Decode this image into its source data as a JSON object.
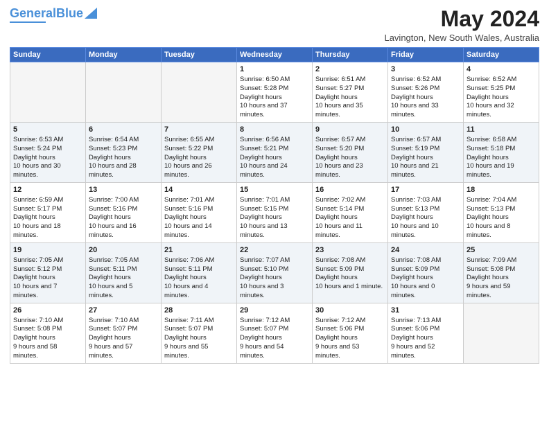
{
  "header": {
    "logo_general": "General",
    "logo_blue": "Blue",
    "month_title": "May 2024",
    "location": "Lavington, New South Wales, Australia"
  },
  "days_of_week": [
    "Sunday",
    "Monday",
    "Tuesday",
    "Wednesday",
    "Thursday",
    "Friday",
    "Saturday"
  ],
  "weeks": [
    [
      {
        "day": "",
        "empty": true,
        "sunrise": "",
        "sunset": "",
        "daylight": ""
      },
      {
        "day": "",
        "empty": true,
        "sunrise": "",
        "sunset": "",
        "daylight": ""
      },
      {
        "day": "",
        "empty": true,
        "sunrise": "",
        "sunset": "",
        "daylight": ""
      },
      {
        "day": "1",
        "empty": false,
        "sunrise": "6:50 AM",
        "sunset": "5:28 PM",
        "daylight": "10 hours and 37 minutes."
      },
      {
        "day": "2",
        "empty": false,
        "sunrise": "6:51 AM",
        "sunset": "5:27 PM",
        "daylight": "10 hours and 35 minutes."
      },
      {
        "day": "3",
        "empty": false,
        "sunrise": "6:52 AM",
        "sunset": "5:26 PM",
        "daylight": "10 hours and 33 minutes."
      },
      {
        "day": "4",
        "empty": false,
        "sunrise": "6:52 AM",
        "sunset": "5:25 PM",
        "daylight": "10 hours and 32 minutes."
      }
    ],
    [
      {
        "day": "5",
        "empty": false,
        "sunrise": "6:53 AM",
        "sunset": "5:24 PM",
        "daylight": "10 hours and 30 minutes."
      },
      {
        "day": "6",
        "empty": false,
        "sunrise": "6:54 AM",
        "sunset": "5:23 PM",
        "daylight": "10 hours and 28 minutes."
      },
      {
        "day": "7",
        "empty": false,
        "sunrise": "6:55 AM",
        "sunset": "5:22 PM",
        "daylight": "10 hours and 26 minutes."
      },
      {
        "day": "8",
        "empty": false,
        "sunrise": "6:56 AM",
        "sunset": "5:21 PM",
        "daylight": "10 hours and 24 minutes."
      },
      {
        "day": "9",
        "empty": false,
        "sunrise": "6:57 AM",
        "sunset": "5:20 PM",
        "daylight": "10 hours and 23 minutes."
      },
      {
        "day": "10",
        "empty": false,
        "sunrise": "6:57 AM",
        "sunset": "5:19 PM",
        "daylight": "10 hours and 21 minutes."
      },
      {
        "day": "11",
        "empty": false,
        "sunrise": "6:58 AM",
        "sunset": "5:18 PM",
        "daylight": "10 hours and 19 minutes."
      }
    ],
    [
      {
        "day": "12",
        "empty": false,
        "sunrise": "6:59 AM",
        "sunset": "5:17 PM",
        "daylight": "10 hours and 18 minutes."
      },
      {
        "day": "13",
        "empty": false,
        "sunrise": "7:00 AM",
        "sunset": "5:16 PM",
        "daylight": "10 hours and 16 minutes."
      },
      {
        "day": "14",
        "empty": false,
        "sunrise": "7:01 AM",
        "sunset": "5:16 PM",
        "daylight": "10 hours and 14 minutes."
      },
      {
        "day": "15",
        "empty": false,
        "sunrise": "7:01 AM",
        "sunset": "5:15 PM",
        "daylight": "10 hours and 13 minutes."
      },
      {
        "day": "16",
        "empty": false,
        "sunrise": "7:02 AM",
        "sunset": "5:14 PM",
        "daylight": "10 hours and 11 minutes."
      },
      {
        "day": "17",
        "empty": false,
        "sunrise": "7:03 AM",
        "sunset": "5:13 PM",
        "daylight": "10 hours and 10 minutes."
      },
      {
        "day": "18",
        "empty": false,
        "sunrise": "7:04 AM",
        "sunset": "5:13 PM",
        "daylight": "10 hours and 8 minutes."
      }
    ],
    [
      {
        "day": "19",
        "empty": false,
        "sunrise": "7:05 AM",
        "sunset": "5:12 PM",
        "daylight": "10 hours and 7 minutes."
      },
      {
        "day": "20",
        "empty": false,
        "sunrise": "7:05 AM",
        "sunset": "5:11 PM",
        "daylight": "10 hours and 5 minutes."
      },
      {
        "day": "21",
        "empty": false,
        "sunrise": "7:06 AM",
        "sunset": "5:11 PM",
        "daylight": "10 hours and 4 minutes."
      },
      {
        "day": "22",
        "empty": false,
        "sunrise": "7:07 AM",
        "sunset": "5:10 PM",
        "daylight": "10 hours and 3 minutes."
      },
      {
        "day": "23",
        "empty": false,
        "sunrise": "7:08 AM",
        "sunset": "5:09 PM",
        "daylight": "10 hours and 1 minute."
      },
      {
        "day": "24",
        "empty": false,
        "sunrise": "7:08 AM",
        "sunset": "5:09 PM",
        "daylight": "10 hours and 0 minutes."
      },
      {
        "day": "25",
        "empty": false,
        "sunrise": "7:09 AM",
        "sunset": "5:08 PM",
        "daylight": "9 hours and 59 minutes."
      }
    ],
    [
      {
        "day": "26",
        "empty": false,
        "sunrise": "7:10 AM",
        "sunset": "5:08 PM",
        "daylight": "9 hours and 58 minutes."
      },
      {
        "day": "27",
        "empty": false,
        "sunrise": "7:10 AM",
        "sunset": "5:07 PM",
        "daylight": "9 hours and 57 minutes."
      },
      {
        "day": "28",
        "empty": false,
        "sunrise": "7:11 AM",
        "sunset": "5:07 PM",
        "daylight": "9 hours and 55 minutes."
      },
      {
        "day": "29",
        "empty": false,
        "sunrise": "7:12 AM",
        "sunset": "5:07 PM",
        "daylight": "9 hours and 54 minutes."
      },
      {
        "day": "30",
        "empty": false,
        "sunrise": "7:12 AM",
        "sunset": "5:06 PM",
        "daylight": "9 hours and 53 minutes."
      },
      {
        "day": "31",
        "empty": false,
        "sunrise": "7:13 AM",
        "sunset": "5:06 PM",
        "daylight": "9 hours and 52 minutes."
      },
      {
        "day": "",
        "empty": true,
        "sunrise": "",
        "sunset": "",
        "daylight": ""
      }
    ]
  ]
}
